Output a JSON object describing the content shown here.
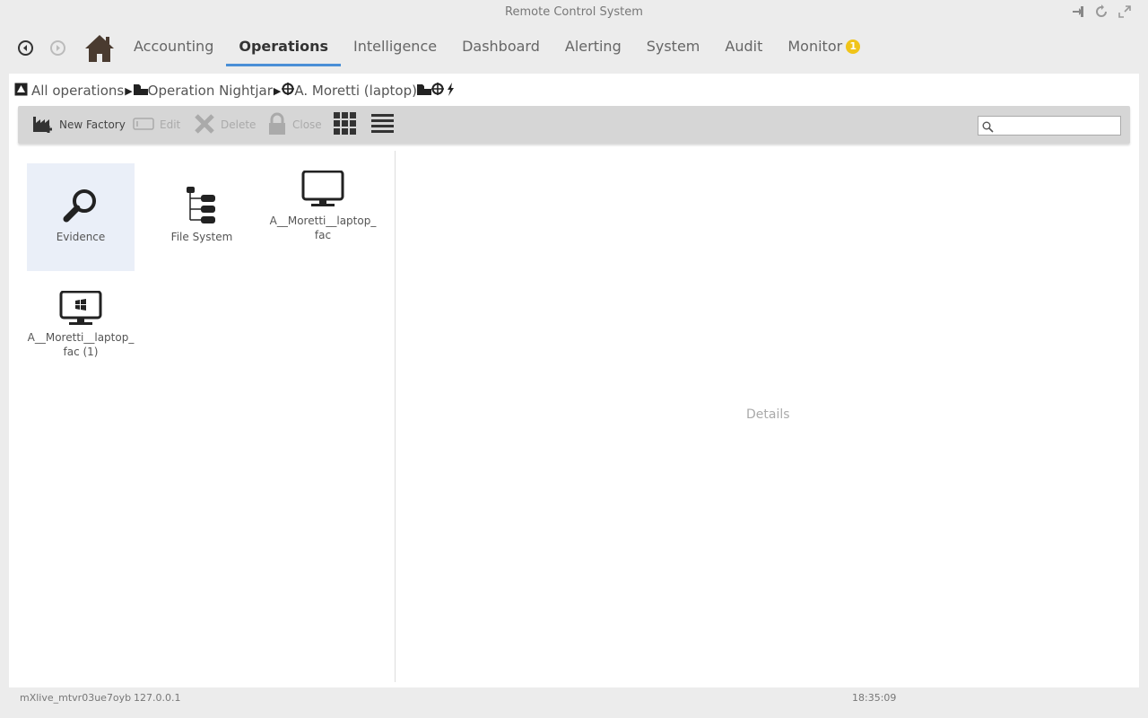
{
  "window": {
    "title": "Remote Control System"
  },
  "nav": {
    "tabs": [
      {
        "label": "Accounting"
      },
      {
        "label": "Operations"
      },
      {
        "label": "Intelligence"
      },
      {
        "label": "Dashboard"
      },
      {
        "label": "Alerting"
      },
      {
        "label": "System"
      },
      {
        "label": "Audit"
      },
      {
        "label": "Monitor"
      }
    ],
    "active_tab": "Operations",
    "monitor_badge": "1"
  },
  "breadcrumb": {
    "root": "All operations",
    "operation": "Operation Nightjar",
    "target": "A. Moretti (laptop)"
  },
  "toolbar": {
    "new_factory": "New Factory",
    "edit": "Edit",
    "delete": "Delete",
    "close": "Close",
    "search_placeholder": ""
  },
  "items": [
    {
      "label": "Evidence",
      "icon": "magnifier-icon"
    },
    {
      "label": "File System",
      "icon": "tree-icon"
    },
    {
      "label": "A__Moretti__laptop_ fac",
      "icon": "monitor-icon"
    },
    {
      "label": "A__Moretti__laptop_ fac (1)",
      "icon": "windows-monitor-icon"
    }
  ],
  "details": {
    "placeholder": "Details"
  },
  "status": {
    "session": "mXlive_mtvr03ue7oyb",
    "ip": "127.0.0.1",
    "time": "18:35:09"
  },
  "colors": {
    "accent": "#4a8fd6",
    "badge": "#f0c419",
    "selected_tile": "#eaeff8"
  }
}
